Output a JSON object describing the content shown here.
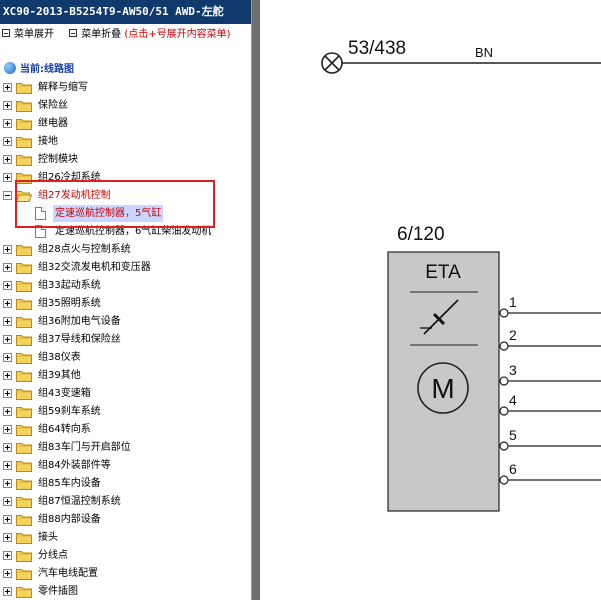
{
  "window": {
    "title": "XC90-2013-B5254T9-AW50/51 AWD-左舵"
  },
  "toolbar": {
    "expand_label": "菜单展开",
    "collapse_label": "菜单折叠",
    "hint": "(点击+号展开内容菜单)"
  },
  "tree": {
    "current_label": "当前:线路图",
    "items": [
      {
        "label": "解释与缩写",
        "expanded": false
      },
      {
        "label": "保险丝",
        "expanded": false
      },
      {
        "label": "继电器",
        "expanded": false
      },
      {
        "label": "接地",
        "expanded": false
      },
      {
        "label": "控制模块",
        "expanded": false
      },
      {
        "label": "组26冷却系统",
        "expanded": false
      },
      {
        "label": "组27发动机控制",
        "expanded": true
      },
      {
        "label": "组28点火与控制系统",
        "expanded": false
      },
      {
        "label": "组32交流发电机和变压器",
        "expanded": false
      },
      {
        "label": "组33起动系统",
        "expanded": false
      },
      {
        "label": "组35照明系统",
        "expanded": false
      },
      {
        "label": "组36附加电气设备",
        "expanded": false
      },
      {
        "label": "组37导线和保险丝",
        "expanded": false
      },
      {
        "label": "组38仪表",
        "expanded": false
      },
      {
        "label": "组39其他",
        "expanded": false
      },
      {
        "label": "组43变速箱",
        "expanded": false
      },
      {
        "label": "组59刹车系统",
        "expanded": false
      },
      {
        "label": "组64转向系",
        "expanded": false
      },
      {
        "label": "组83车门与开启部位",
        "expanded": false
      },
      {
        "label": "组84外装部件等",
        "expanded": false
      },
      {
        "label": "组85车内设备",
        "expanded": false
      },
      {
        "label": "组87恒温控制系统",
        "expanded": false
      },
      {
        "label": "组88内部设备",
        "expanded": false
      },
      {
        "label": "接头",
        "expanded": false
      },
      {
        "label": "分线点",
        "expanded": false
      },
      {
        "label": "汽车电线配置",
        "expanded": false
      },
      {
        "label": "零件插图",
        "expanded": false
      }
    ],
    "children": [
      {
        "label": "定速巡航控制器，5气缸",
        "selected": true
      },
      {
        "label": "定速巡航控制器，6气缸柴油发动机",
        "selected": false
      }
    ]
  },
  "diagram": {
    "wire_ref": "53/438",
    "wire_color": "BN",
    "component_ref": "6/120",
    "component_name": "ETA",
    "motor_symbol": "M",
    "pins": [
      "1",
      "2",
      "3",
      "4",
      "5",
      "6"
    ]
  },
  "colors": {
    "title_bar": "#103a6e",
    "selected_text": "#d00000",
    "highlight_box": "#e02020",
    "component_fill": "#c8c8c8"
  }
}
